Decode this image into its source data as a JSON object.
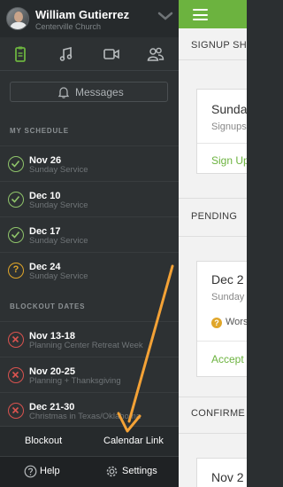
{
  "profile": {
    "name": "William Gutierrez",
    "org": "Centerville Church"
  },
  "icons": {
    "tab1": "clipboard-icon",
    "tab2": "music-note-icon",
    "tab3": "video-camera-icon",
    "tab4": "people-icon"
  },
  "messages": {
    "label": "Messages"
  },
  "schedule": {
    "heading": "MY SCHEDULE",
    "items": [
      {
        "date": "Nov 26",
        "sub": "Sunday Service",
        "status": "confirmed"
      },
      {
        "date": "Dec 10",
        "sub": "Sunday Service",
        "status": "confirmed"
      },
      {
        "date": "Dec 17",
        "sub": "Sunday Service",
        "status": "confirmed"
      },
      {
        "date": "Dec 24",
        "sub": "Sunday Service",
        "status": "pending"
      }
    ]
  },
  "blockouts": {
    "heading": "BLOCKOUT DATES",
    "items": [
      {
        "date": "Nov 13-18",
        "sub": "Planning Center Retreat Week"
      },
      {
        "date": "Nov 20-25",
        "sub": "Planning + Thanksgiving"
      },
      {
        "date": "Dec 21-30",
        "sub": "Christmas in Texas/Oklahoma"
      }
    ]
  },
  "footer": {
    "blockout": "Blockout",
    "calendar_link": "Calendar Link",
    "help": "Help",
    "settings": "Settings"
  },
  "main": {
    "signup_heading": "SIGNUP SH",
    "signup_card": {
      "title": "Sunda",
      "sub": "Signups",
      "action": "Sign Up"
    },
    "pending_heading": "PENDING",
    "pending_card": {
      "title": "Dec 2",
      "sub": "Sunday",
      "note": "Wors",
      "action": "Accept"
    },
    "confirmed_heading": "CONFIRME",
    "confirmed_card": {
      "title": "Nov 2"
    }
  },
  "colors": {
    "accent": "#6cb33f",
    "pending": "#e0a62a",
    "blockout": "#d9534f",
    "annotation": "#f4a236"
  }
}
